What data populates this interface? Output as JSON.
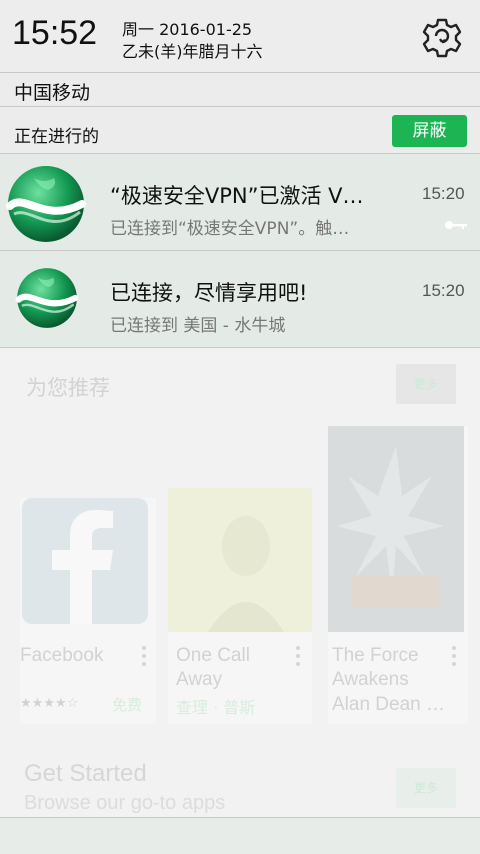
{
  "status": {
    "time": "15:52",
    "date_line1": "周一 2016-01-25",
    "date_line2": "乙未(羊)年腊月十六"
  },
  "carrier": "中国移动",
  "ongoing": {
    "label": "正在进行的",
    "hide_button": "屏蔽"
  },
  "notifications": [
    {
      "title": "“极速安全VPN”已激活 V…",
      "subtitle": "已连接到“极速安全VPN”。触…",
      "time": "15:20",
      "icon": "vpn-globe-icon",
      "extra_icon": "key-icon"
    },
    {
      "title": "已连接，尽情享用吧!",
      "subtitle": "已连接到 美国 - 水牛城",
      "time": "15:20",
      "icon": "vpn-globe-icon"
    }
  ],
  "store": {
    "recommend_title": "为您推荐",
    "more_label": "更多",
    "cards": [
      {
        "title": "Facebook",
        "subtitle": "★★★★☆",
        "price": "免费"
      },
      {
        "title": "One Call Away",
        "subtitle": "查理 · 普斯"
      },
      {
        "title": "The Force Awakens",
        "subtitle": "Alan Dean …"
      }
    ],
    "get_started_title": "Get Started",
    "get_started_sub": "Browse our go-to apps",
    "get_started_more": "更多"
  },
  "colors": {
    "accent": "#1db454",
    "notif_bg": "#e4ebe6"
  }
}
